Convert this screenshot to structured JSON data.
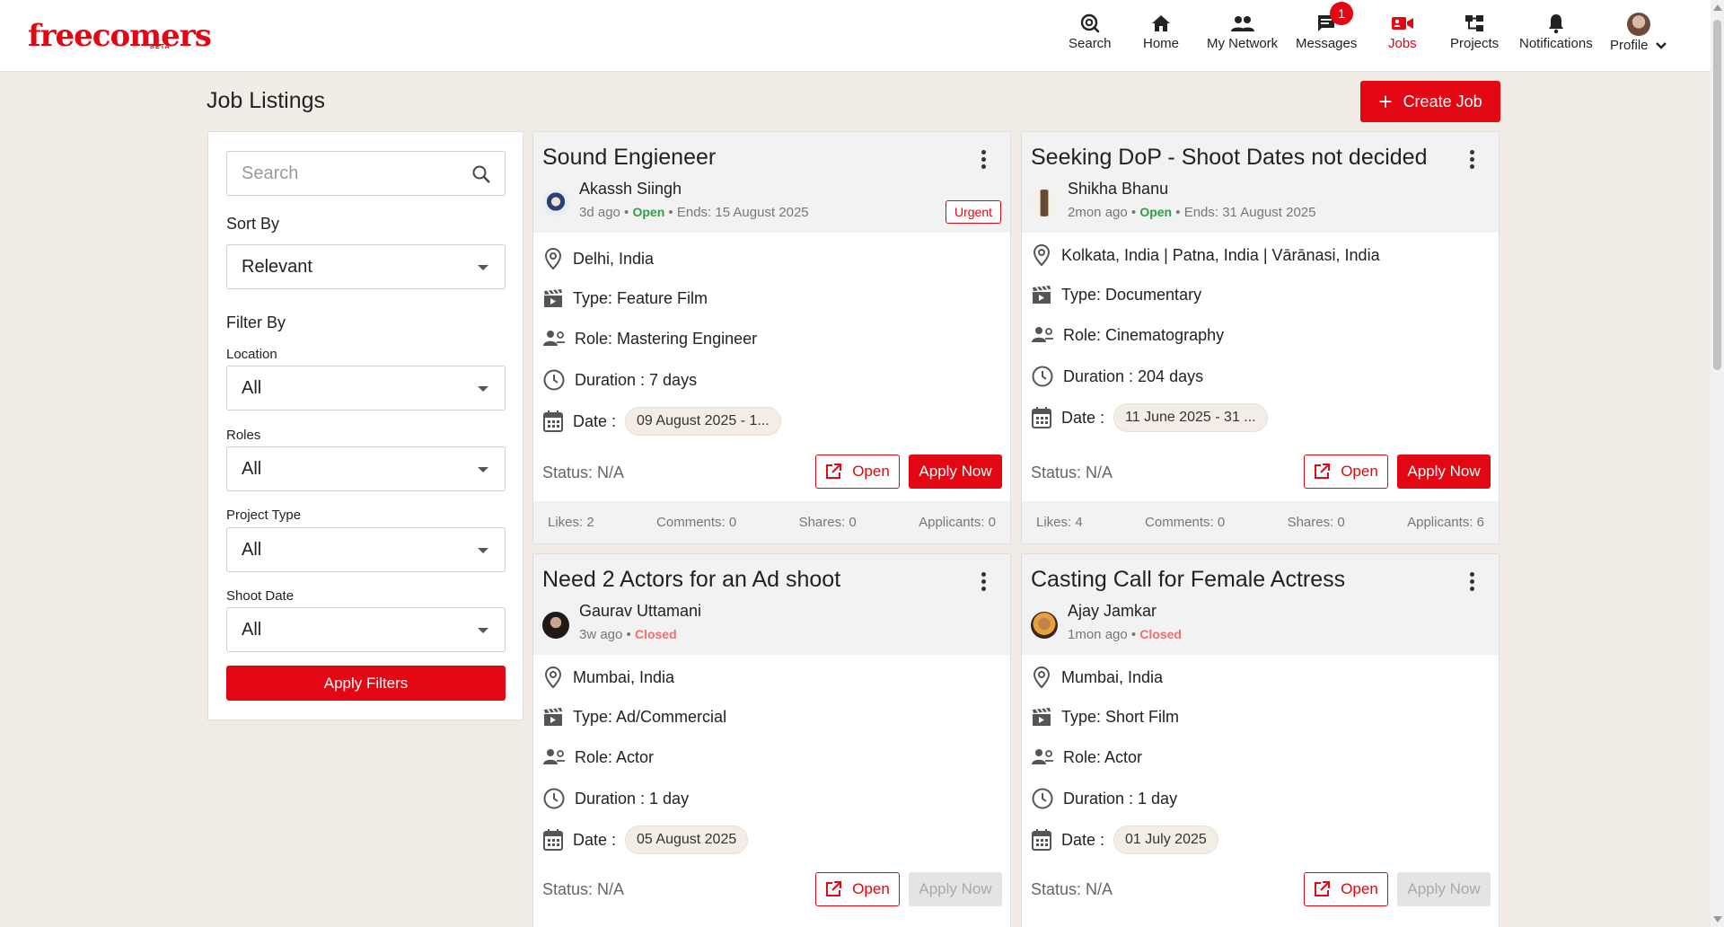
{
  "brand": {
    "logo": "freecomers",
    "beta": "BETA"
  },
  "nav": {
    "search": "Search",
    "home": "Home",
    "network": "My Network",
    "messages": "Messages",
    "messages_badge": "1",
    "jobs": "Jobs",
    "projects": "Projects",
    "notifications": "Notifications",
    "profile": "Profile"
  },
  "page": {
    "title": "Job Listings",
    "create_button": "Create Job"
  },
  "filters": {
    "search_placeholder": "Search",
    "sort_label": "Sort By",
    "sort_value": "Relevant",
    "filter_label": "Filter By",
    "location_label": "Location",
    "location_value": "All",
    "roles_label": "Roles",
    "roles_value": "All",
    "project_type_label": "Project Type",
    "project_type_value": "All",
    "shoot_date_label": "Shoot Date",
    "shoot_date_value": "All",
    "apply_button": "Apply Filters"
  },
  "jobs": [
    {
      "title": "Sound Engieneer",
      "poster": "Akassh Siingh",
      "age": "3d ago",
      "state": "Open",
      "ends": "Ends: 15 August 2025",
      "urgent": "Urgent",
      "location": "Delhi, India",
      "type": "Type: Feature Film",
      "role": "Role: Mastering Engineer",
      "duration": "Duration : 7 days",
      "date_label": "Date :",
      "date": "09 August 2025 - 1...",
      "status": "Status: N/A",
      "open_btn": "Open",
      "apply_btn": "Apply Now",
      "likes": "Likes:  2",
      "comments": "Comments:  0",
      "shares": "Shares:  0",
      "applicants": "Applicants:  0"
    },
    {
      "title": "Seeking DoP - Shoot Dates not decided",
      "poster": "Shikha Bhanu",
      "age": "2mon ago",
      "state": "Open",
      "ends": "Ends: 31 August 2025",
      "location": "Kolkata, India | Patna, India | Vārānasi, India",
      "type": "Type: Documentary",
      "role": "Role: Cinematography",
      "duration": "Duration : 204 days",
      "date_label": "Date :",
      "date": "11 June 2025 - 31 ...",
      "status": "Status: N/A",
      "open_btn": "Open",
      "apply_btn": "Apply Now",
      "likes": "Likes:  4",
      "comments": "Comments:  0",
      "shares": "Shares:  0",
      "applicants": "Applicants:  6"
    },
    {
      "title": "Need 2 Actors for an Ad shoot",
      "poster": "Gaurav Uttamani",
      "age": "3w ago",
      "state": "Closed",
      "location": "Mumbai, India",
      "type": "Type: Ad/Commercial",
      "role": "Role: Actor",
      "duration": "Duration : 1 day",
      "date_label": "Date :",
      "date": "05 August 2025",
      "status": "Status: N/A",
      "open_btn": "Open",
      "apply_btn": "Apply Now"
    },
    {
      "title": "Casting Call for Female Actress",
      "poster": "Ajay Jamkar",
      "age": "1mon ago",
      "state": "Closed",
      "location": "Mumbai, India",
      "type": "Type: Short Film",
      "role": "Role: Actor",
      "duration": "Duration : 1 day",
      "date_label": "Date :",
      "date": "01 July 2025",
      "status": "Status: N/A",
      "open_btn": "Open",
      "apply_btn": "Apply Now"
    }
  ],
  "colors": {
    "brand": "#e30613",
    "open": "#2ea043",
    "closed": "#ef6f6f"
  }
}
